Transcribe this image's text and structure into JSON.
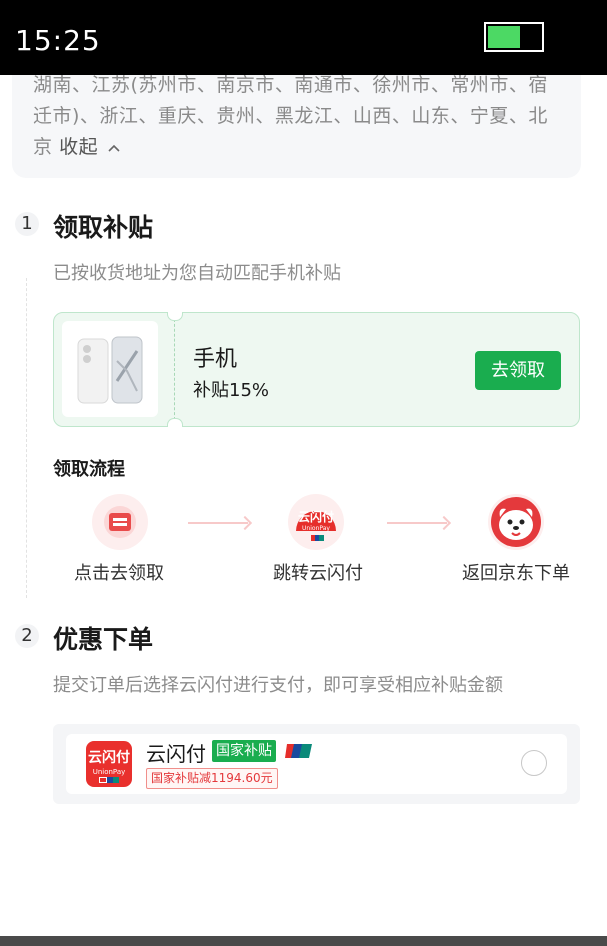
{
  "status_bar": {
    "time": "15:25"
  },
  "region": {
    "text": "湖南、江苏(苏州市、南京市、南通市、徐州市、常州市、宿迁市)、浙江、重庆、贵州、黑龙江、山西、山东、宁夏、北京",
    "collapse_label": "收起"
  },
  "step1": {
    "number": "1",
    "title": "领取补贴",
    "description": "已按收货地址为您自动匹配手机补贴",
    "card": {
      "name": "手机",
      "rate": "补贴15%",
      "button_label": "去领取"
    },
    "flow": {
      "title": "领取流程",
      "steps": [
        {
          "label": "点击去领取",
          "icon": "coupon-icon"
        },
        {
          "label": "跳转云闪付",
          "icon": "unionpay-cloud-icon",
          "icon_text": "云闪付",
          "icon_sub": "UnionPay"
        },
        {
          "label": "返回京东下单",
          "icon": "jd-dog-icon"
        }
      ]
    }
  },
  "step2": {
    "number": "2",
    "title": "优惠下单",
    "description": "提交订单后选择云闪付进行支付，即可享受相应补贴金额",
    "payment": {
      "logo_text": "云闪付",
      "logo_sub": "UnionPay",
      "name": "云闪付",
      "tag": "国家补贴",
      "discount": "国家补贴减1194.60元"
    }
  },
  "colors": {
    "green": "#1aad4f",
    "red": "#e4393c",
    "card_bg": "#eef8f1"
  }
}
